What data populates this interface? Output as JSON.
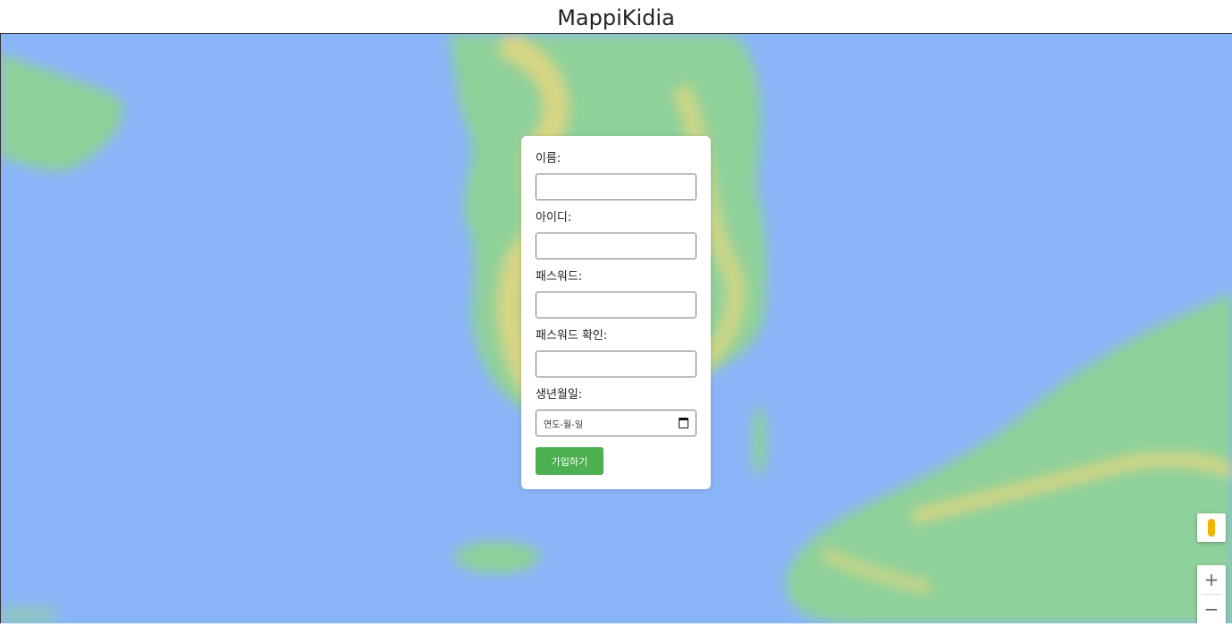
{
  "app": {
    "title": "MappiKidia"
  },
  "form": {
    "name_label": "이름:",
    "id_label": "아이디:",
    "password_label": "패스워드:",
    "password_confirm_label": "패스워드 확인:",
    "birthdate_label": "생년월일:",
    "birthdate_placeholder": "연도-월-일",
    "submit_label": "가입하기"
  },
  "map_controls": {
    "zoom_in": "+",
    "zoom_out": "−"
  },
  "colors": {
    "water": "#8ab4f8",
    "land": "#7fcf85",
    "urban": "#f5d77a",
    "submit": "#4caf50"
  },
  "icons": [
    "pegman-icon",
    "calendar-icon"
  ]
}
